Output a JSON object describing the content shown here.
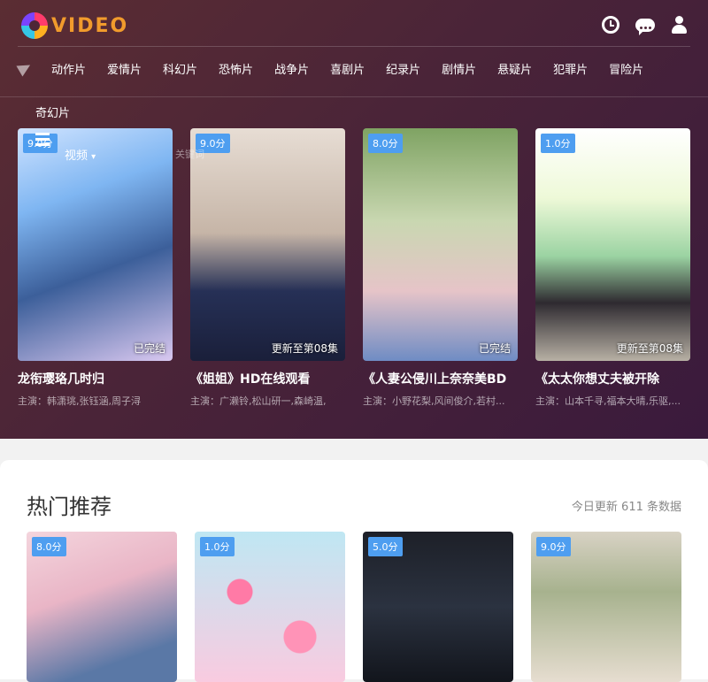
{
  "logo": {
    "text": "VIDEO"
  },
  "header_icons": [
    "clock-icon",
    "chat-icon",
    "user-icon"
  ],
  "nav": {
    "items": [
      "动作片",
      "爱情片",
      "科幻片",
      "恐怖片",
      "战争片",
      "喜剧片",
      "纪录片",
      "剧情片",
      "悬疑片",
      "犯罪片",
      "冒险片"
    ],
    "second_row": "奇幻片"
  },
  "overlay": {
    "video_label": "视频",
    "shortcut": "关键词"
  },
  "hero_cards": [
    {
      "score": "9.0分",
      "status": "已完结",
      "title": "龙衔璎珞几时归",
      "actors": "主演：韩潇珧,张钰涵,周子浔"
    },
    {
      "score": "9.0分",
      "status": "更新至第08集",
      "title": "《姐姐》HD在线观看",
      "actors": "主演：广濑铃,松山研一,森崎温,"
    },
    {
      "score": "8.0分",
      "status": "已完结",
      "title": "《人妻公侵川上奈奈美BD",
      "actors": "主演：小野花梨,风间俊介,若村..."
    },
    {
      "score": "1.0分",
      "status": "更新至第08集",
      "title": "《太太你想丈夫被开除",
      "actors": "主演：山本千寻,福本大晴,乐驱,..."
    }
  ],
  "hot": {
    "title": "热门推荐",
    "meta": "今日更新 611 条数据",
    "cards": [
      {
        "score": "8.0分"
      },
      {
        "score": "1.0分"
      },
      {
        "score": "5.0分"
      },
      {
        "score": "9.0分"
      }
    ]
  },
  "colors": {
    "accent": "#4e9ef0",
    "hero_bg": "#4a2438"
  }
}
